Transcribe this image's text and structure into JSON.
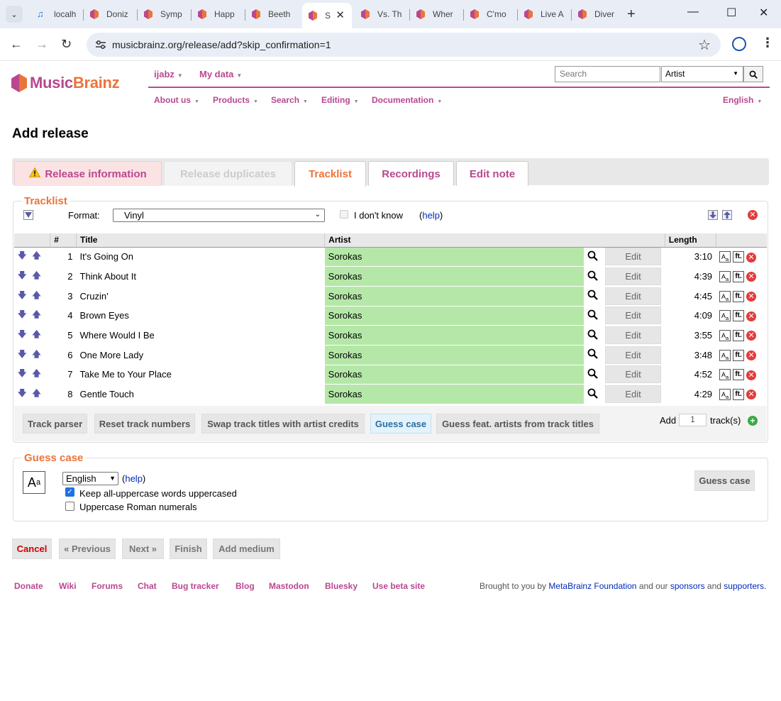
{
  "browser": {
    "tabs": [
      {
        "label": "localh",
        "icon": "music-note-icon"
      },
      {
        "label": "Doniz",
        "icon": "musicbrainz-icon"
      },
      {
        "label": "Symp",
        "icon": "musicbrainz-icon"
      },
      {
        "label": "Happ",
        "icon": "musicbrainz-icon"
      },
      {
        "label": "Beeth",
        "icon": "musicbrainz-icon"
      },
      {
        "label": "S",
        "icon": "musicbrainz-icon",
        "active": true
      },
      {
        "label": "Vs. Th",
        "icon": "musicbrainz-icon"
      },
      {
        "label": "Wher",
        "icon": "musicbrainz-icon"
      },
      {
        "label": "C'mo",
        "icon": "musicbrainz-icon"
      },
      {
        "label": "Live A",
        "icon": "musicbrainz-icon"
      },
      {
        "label": "Diver",
        "icon": "musicbrainz-icon"
      }
    ],
    "url": "musicbrainz.org/release/add?skip_confirmation=1"
  },
  "site": {
    "logo_music": "Music",
    "logo_brainz": "Brainz",
    "user": "ijabz",
    "my_data": "My data",
    "search_placeholder": "Search",
    "search_type": "Artist",
    "menu": [
      "About us",
      "Products",
      "Search",
      "Editing",
      "Documentation"
    ],
    "language": "English"
  },
  "page": {
    "title": "Add release",
    "tabs": [
      "Release information",
      "Release duplicates",
      "Tracklist",
      "Recordings",
      "Edit note"
    ]
  },
  "tracklist": {
    "legend": "Tracklist",
    "format_label": "Format:",
    "format_value": "Vinyl",
    "dont_know": "I don't know",
    "help_open": "(",
    "help": "help",
    "help_close": ")",
    "headers": {
      "pos": "#",
      "title": "Title",
      "artist": "Artist",
      "length": "Length"
    },
    "edit_label": "Edit",
    "tracks": [
      {
        "pos": "1",
        "title": "It's Going On",
        "artist": "Sorokas",
        "length": "3:10"
      },
      {
        "pos": "2",
        "title": "Think About It",
        "artist": "Sorokas",
        "length": "4:39"
      },
      {
        "pos": "3",
        "title": "Cruzin'",
        "artist": "Sorokas",
        "length": "4:45"
      },
      {
        "pos": "4",
        "title": "Brown Eyes",
        "artist": "Sorokas",
        "length": "4:09"
      },
      {
        "pos": "5",
        "title": "Where Would I Be",
        "artist": "Sorokas",
        "length": "3:55"
      },
      {
        "pos": "6",
        "title": "One More Lady",
        "artist": "Sorokas",
        "length": "3:48"
      },
      {
        "pos": "7",
        "title": "Take Me to Your Place",
        "artist": "Sorokas",
        "length": "4:52"
      },
      {
        "pos": "8",
        "title": "Gentle Touch",
        "artist": "Sorokas",
        "length": "4:29"
      }
    ],
    "buttons": [
      "Track parser",
      "Reset track numbers",
      "Swap track titles with artist credits",
      "Guess case",
      "Guess feat. artists from track titles"
    ],
    "add_label": "Add",
    "add_count": "1",
    "add_suffix": "track(s)"
  },
  "guess_case": {
    "legend": "Guess case",
    "language": "English",
    "help": "help",
    "opt1": "Keep all-uppercase words uppercased",
    "opt1_checked": true,
    "opt2": "Uppercase Roman numerals",
    "opt2_checked": false,
    "button": "Guess case"
  },
  "nav_buttons": [
    "Cancel",
    "« Previous",
    "Next »",
    "Finish",
    "Add medium"
  ],
  "footer": {
    "links": [
      "Donate",
      "Wiki",
      "Forums",
      "Chat",
      "Bug tracker",
      "Blog",
      "Mastodon",
      "Bluesky",
      "Use beta site"
    ],
    "credits_1": "Brought to you by",
    "credits_org": "MetaBrainz Foundation",
    "credits_2": "and our",
    "credits_sponsors": "sponsors",
    "credits_3": "and",
    "credits_supporters": "supporters."
  },
  "colors": {
    "brand_purple": "#ba478f",
    "brand_orange": "#eb743b",
    "artist_green": "#b5e8a8"
  }
}
